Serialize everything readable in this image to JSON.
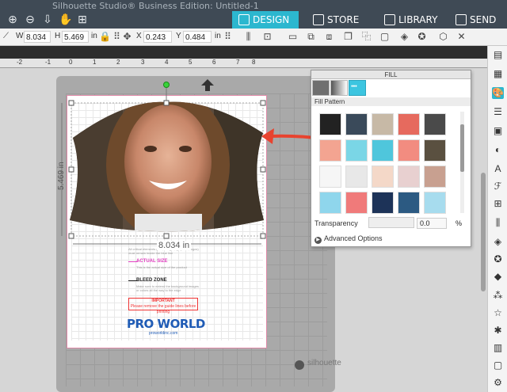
{
  "app": {
    "title": "Silhouette Studio® Business Edition: Untitled-1"
  },
  "nav": {
    "tabs": [
      {
        "label": "DESIGN",
        "active": true
      },
      {
        "label": "STORE",
        "active": false
      },
      {
        "label": "LIBRARY",
        "active": false
      },
      {
        "label": "SEND",
        "active": false
      }
    ]
  },
  "toolbar": {
    "w_label": "W",
    "w_value": "8.034",
    "h_label": "H",
    "h_value": "5.469",
    "unit": "in",
    "x_label": "X",
    "x_value": "0.243",
    "y_label": "Y",
    "y_value": "0.484"
  },
  "ruler": {
    "ticks": [
      "-2",
      "-1",
      "0",
      "1",
      "2",
      "3",
      "4",
      "5",
      "6",
      "7",
      "8"
    ]
  },
  "canvas": {
    "width_label": "8.034 in",
    "height_label": "5.469 in",
    "watermark": "silhouette"
  },
  "template": {
    "actual_size": "ACTUAL SIZE",
    "bleed_zone": "BLEED ZONE",
    "important_title": "IMPORTANT",
    "important_text": "Please remove the guide lines before printing",
    "brand": "PRO WORLD",
    "brand_url": "proworldinc.com"
  },
  "fill_panel": {
    "title": "FILL",
    "section_label": "Fill Pattern",
    "transparency_label": "Transparency",
    "transparency_value": "0.0",
    "transparency_unit": "%",
    "advanced_label": "Advanced Options",
    "swatches": [
      "#222222",
      "#3a4a5a",
      "#c7b9a6",
      "#e66a5e",
      "#4a4a4a",
      "#f3a491",
      "#7ad6e6",
      "#4fc6dc",
      "#f28c80",
      "#5a5040",
      "#f6f6f6",
      "#e8e8e8",
      "#f4d8c8",
      "#e8d0d0",
      "#c8a090",
      "#8fd6ec",
      "#f07a7a",
      "#1d3358",
      "#2c5a82",
      "#a7dcee"
    ]
  },
  "colors": {
    "accent": "#2cb7cf",
    "titlebar": "#3f4a55",
    "arrow": "#e8432f"
  }
}
